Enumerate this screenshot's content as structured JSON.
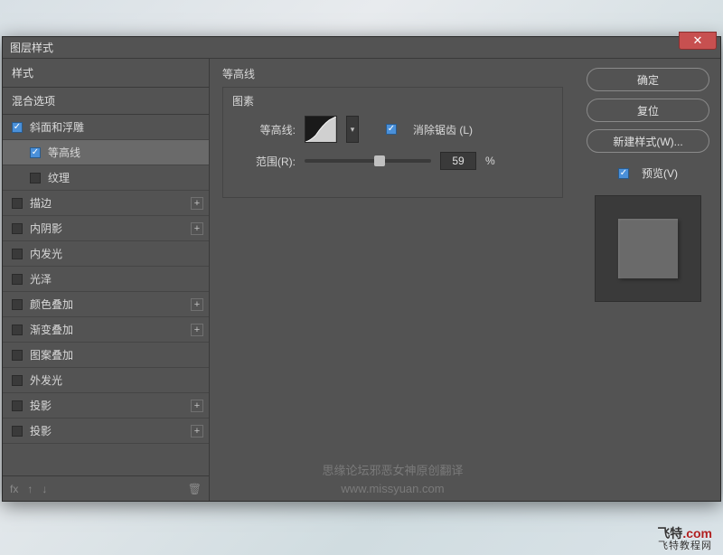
{
  "dialog": {
    "title": "图层样式"
  },
  "left": {
    "styles_header": "样式",
    "blending_options": "混合选项",
    "items": [
      {
        "label": "斜面和浮雕",
        "checked": true,
        "indent": false,
        "plus": false
      },
      {
        "label": "等高线",
        "checked": true,
        "indent": true,
        "plus": false,
        "selected": true
      },
      {
        "label": "纹理",
        "checked": false,
        "indent": true,
        "plus": false
      },
      {
        "label": "描边",
        "checked": false,
        "indent": false,
        "plus": true
      },
      {
        "label": "内阴影",
        "checked": false,
        "indent": false,
        "plus": true
      },
      {
        "label": "内发光",
        "checked": false,
        "indent": false,
        "plus": false
      },
      {
        "label": "光泽",
        "checked": false,
        "indent": false,
        "plus": false
      },
      {
        "label": "颜色叠加",
        "checked": false,
        "indent": false,
        "plus": true
      },
      {
        "label": "渐变叠加",
        "checked": false,
        "indent": false,
        "plus": true
      },
      {
        "label": "图案叠加",
        "checked": false,
        "indent": false,
        "plus": false
      },
      {
        "label": "外发光",
        "checked": false,
        "indent": false,
        "plus": false
      },
      {
        "label": "投影",
        "checked": false,
        "indent": false,
        "plus": true
      },
      {
        "label": "投影",
        "checked": false,
        "indent": false,
        "plus": true
      }
    ],
    "footer": {
      "fx": "fx",
      "up": "↑",
      "down": "↓",
      "trash": "🗑"
    }
  },
  "mid": {
    "section_title": "等高线",
    "elements_label": "图素",
    "contour_label": "等高线:",
    "antialias_label": "消除锯齿 (L)",
    "antialias_checked": true,
    "range_label": "范围(R):",
    "range_value": "59",
    "range_percent": 59,
    "percent_sign": "%"
  },
  "right": {
    "ok": "确定",
    "reset": "复位",
    "new_style": "新建样式(W)...",
    "preview_label": "预览(V)",
    "preview_checked": true
  },
  "watermark": {
    "line1": "思缘论坛邪恶女神原创翻译",
    "line2": "www.missyuan.com"
  },
  "logo": {
    "main1": "飞特",
    "main2": ".com",
    "sub": "飞特教程网"
  }
}
